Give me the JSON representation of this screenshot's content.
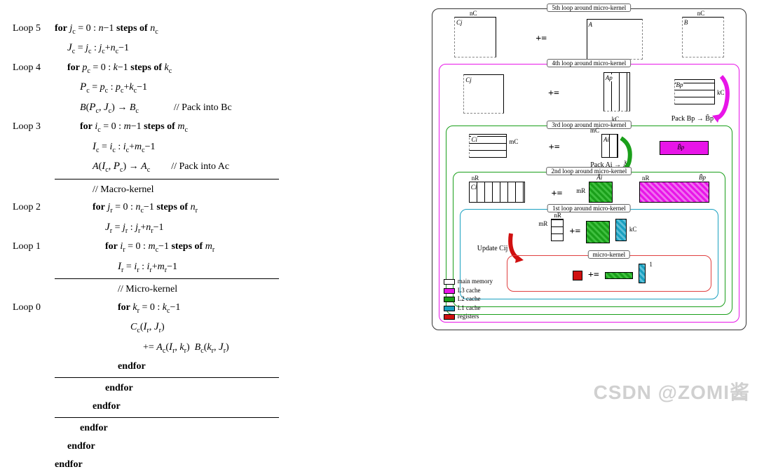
{
  "algo": {
    "loop5_label": "Loop 5",
    "loop4_label": "Loop 4",
    "loop3_label": "Loop 3",
    "loop2_label": "Loop 2",
    "loop1_label": "Loop 1",
    "loop0_label": "Loop 0",
    "loop5": "for jc = 0 : n−1 steps of nc",
    "loop5b": "Jc = jc : jc+nc−1",
    "loop4": "for pc = 0 : k−1 steps of kc",
    "loop4b": "Pc = pc : pc+kc−1",
    "loop4c": "B(Pc, Jc) → Bc",
    "loop4c_comment": "// Pack into Bc",
    "loop3": "for ic = 0 : m−1 steps of mc",
    "loop3b": "Ic = ic : ic+mc−1",
    "loop3c": "A(Ic, Pc) → Ac",
    "loop3c_comment": "// Pack into Ac",
    "macro_comment": "// Macro-kernel",
    "loop2": "for jr = 0 : nc−1 steps of nr",
    "loop2b": "Jr = jr : jr+nr−1",
    "loop1": "for ir = 0 : mc−1 steps of mr",
    "loop1b": "Ir = ir : ir+mr−1",
    "micro_comment": "// Micro-kernel",
    "loop0": "for kr = 0 : kc−1",
    "loop0b": "Cc(Ir, Jr)",
    "loop0c": "+= Ac(Ir, kr)  Bc(kr, Jr)",
    "endfor": "endfor"
  },
  "diagram": {
    "loop5_title": "5th loop around micro-kernel",
    "loop4_title": "4th loop around micro-kernel",
    "loop3_title": "3rd loop around micro-kernel",
    "loop2_title": "2nd loop around micro-kernel",
    "loop1_title": "1st loop around micro-kernel",
    "micro_title": "micro-kernel",
    "Cj": "Cj",
    "A": "A",
    "B": "B",
    "Ap": "Ap",
    "Bp": "Bp",
    "Ci": "Ci",
    "Ai": "Ai",
    "B_tilde_p": "B̃p",
    "A_tilde_i": "Ãi",
    "pack_B": "Pack Bp → B̃p",
    "pack_A": "Pack Ai → Ãi",
    "update_Cij": "Update Cij",
    "nc": "nC",
    "kc": "kC",
    "mc": "mC",
    "nr": "nR",
    "mr": "mR",
    "one": "1",
    "peq": "+=",
    "legend": {
      "main": "main memory",
      "l3": "L3 cache",
      "l2": "L2 cache",
      "l1": "L1 cache",
      "reg": "registers"
    }
  },
  "watermark": "CSDN @ZOMI酱"
}
